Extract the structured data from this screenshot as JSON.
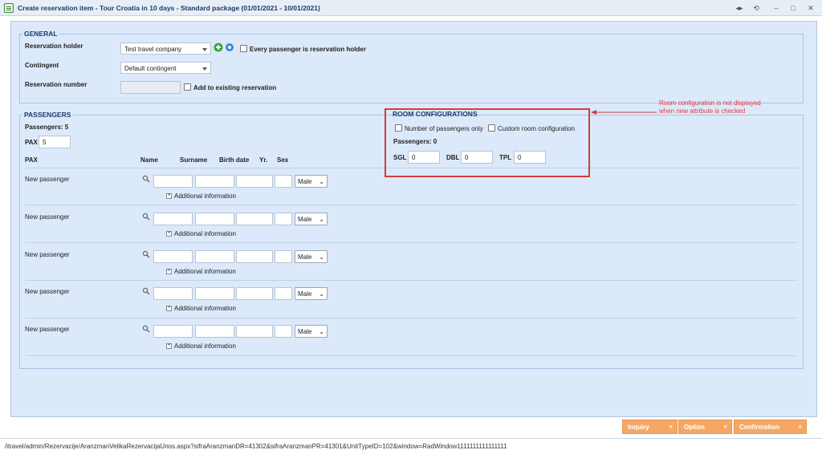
{
  "window": {
    "title": "Create reservation item - Tour Croatia in 10 days - Standard package (01/01/2021 - 10/01/2021)",
    "controls": [
      "◂▸",
      "⟲",
      "–",
      "□",
      "✕"
    ]
  },
  "general": {
    "legend": "GENERAL",
    "reservation_holder_label": "Reservation holder",
    "reservation_holder_value": "Test travel company",
    "every_passenger_label": "Every passenger is reservation holder",
    "contingent_label": "Contingent",
    "contingent_value": "Default contingent",
    "reservation_number_label": "Reservation number",
    "add_existing_label": "Add to existing reservation"
  },
  "passengers": {
    "legend": "PASSENGERS",
    "count_label": "Passengers: 5",
    "pax_label": "PAX",
    "pax_value": "5",
    "headers": {
      "pax": "PAX",
      "name": "Name",
      "surname": "Surname",
      "birth_date": "Birth date",
      "yr": "Yr.",
      "sex": "Sex"
    },
    "rows": [
      {
        "label": "New passenger",
        "sex": "Male",
        "additional": "Additional information"
      },
      {
        "label": "New passenger",
        "sex": "Male",
        "additional": "Additional information"
      },
      {
        "label": "New passenger",
        "sex": "Male",
        "additional": "Additional information"
      },
      {
        "label": "New passenger",
        "sex": "Male",
        "additional": "Additional information"
      },
      {
        "label": "New passenger",
        "sex": "Male",
        "additional": "Additional information"
      }
    ]
  },
  "room_configurations": {
    "legend": "ROOM CONFIGURATIONS",
    "number_of_passengers_only": "Number of passengers only",
    "custom_room_configuration": "Custom room configuration",
    "passengers_count": "Passengers: 0",
    "sgl_label": "SGL",
    "sgl_value": "0",
    "dbl_label": "DBL",
    "dbl_value": "0",
    "tpl_label": "TPL",
    "tpl_value": "0"
  },
  "annotation": {
    "line1": "Room configuration is not displayed",
    "line2": "when new attribute is checked",
    "color": "#e23a3a"
  },
  "buttons": {
    "inquiry": "Inquiry",
    "option": "Option",
    "confirmation": "Confirmation",
    "arrows": "»"
  },
  "status_bar": {
    "url": "/itravel/admin/Rezervacije/AranzmanVelikaRezervacijaUnos.aspx?sifraAranzmanDR=41302&sifraAranzmanPR=41301&UnitTypeID=102&window=RadWindow1111111111111111"
  },
  "colors": {
    "accent": "#1a3a6e",
    "button": "#f6a863",
    "panel": "#dce9fa"
  }
}
